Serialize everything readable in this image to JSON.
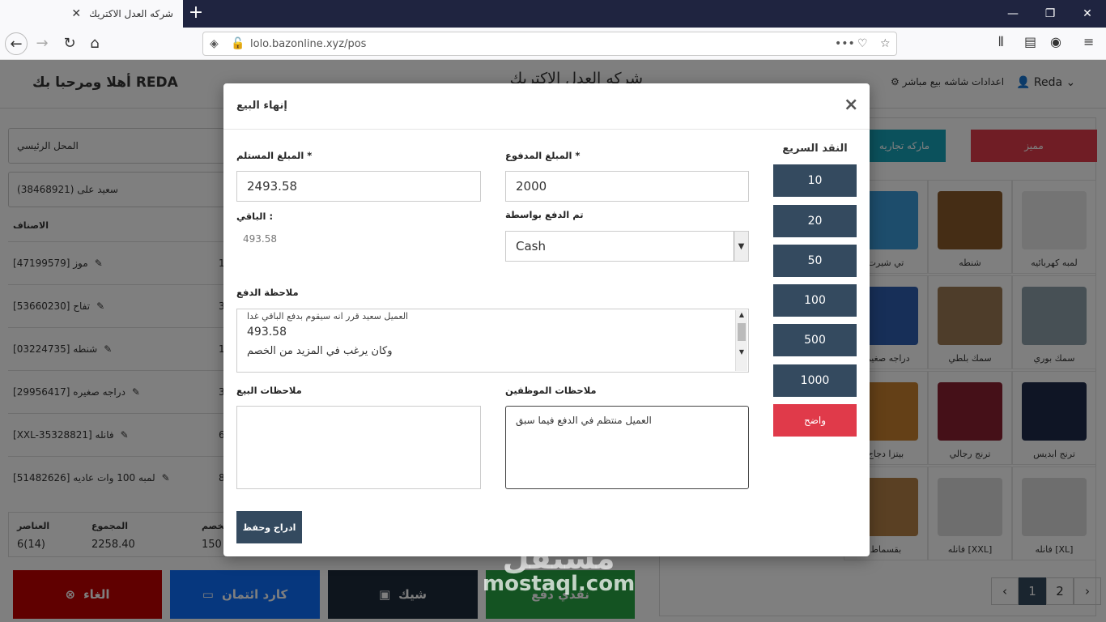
{
  "browser": {
    "tab_title": "شركه العدل الاكتريك",
    "url": "lolo.bazonline.xyz/pos"
  },
  "header": {
    "greeting_name": "REDA",
    "greeting_text": "أهلا ومرحبا بك",
    "company_name": "شركه العدل الاكتريك",
    "settings_label": "اعدادات شاشه بيع مباشر",
    "direct_sale_label": "بيع مباشر",
    "user_name": "Reda"
  },
  "left_panel": {
    "location": "المحل الرئيسي",
    "customer": "سعيد على (38468921)",
    "items_header": "الاصناف",
    "items": [
      {
        "label": "موز [47199579]",
        "qty": "1"
      },
      {
        "label": "تفاح [53660230]",
        "qty": "3"
      },
      {
        "label": "شنطه [03224735]",
        "qty": "1"
      },
      {
        "label": "دراجه صغيره [29956417]",
        "qty": "3"
      },
      {
        "label": "فانله [XXL-35328821]",
        "qty": "6"
      },
      {
        "label": "لمبه 100 وات عاديه [51482626]",
        "qty": "8"
      }
    ],
    "totals": {
      "items_label": "العناصر",
      "items_value": "6(14)",
      "total_label": "المجموع",
      "total_value": "2258.40",
      "discount_label": "الخصم",
      "discount_value": "150"
    }
  },
  "bottom_buttons": {
    "cancel": "الغاء",
    "credit": "كارد ائتمان",
    "cheque": "شيك",
    "cash": "نقدي دفع"
  },
  "right_panel": {
    "category_featured": "مميز",
    "category_brand": "ماركه تجاريه",
    "products": [
      {
        "name": "لمبه كهربائيه",
        "color": "#e8e8e8"
      },
      {
        "name": "شنطه",
        "color": "#8a5a2b"
      },
      {
        "name": "تي شيرت",
        "color": "#3a9ad9"
      },
      {
        "name": "سمك بوري",
        "color": "#8fa0ab"
      },
      {
        "name": "سمك بلطي",
        "color": "#9c7a54"
      },
      {
        "name": "دراجه صغيره",
        "color": "#2f5fb0"
      },
      {
        "name": "ترنج ابديس",
        "color": "#1e2a4a"
      },
      {
        "name": "ترنج رجالي",
        "color": "#8b2030"
      },
      {
        "name": "بيتزا دجاج",
        "color": "#c9812e"
      },
      {
        "name": "فانله [XL]",
        "color": "#dcdcdc"
      },
      {
        "name": "فانله [XXL]",
        "color": "#dcdcdc"
      },
      {
        "name": "بقسماط",
        "color": "#b48046"
      }
    ],
    "pagination": {
      "prev": "‹",
      "page1": "1",
      "page2": "2",
      "next": "›"
    }
  },
  "modal": {
    "title": "إنهاء البيع",
    "close": "×",
    "received_label": "* المبلغ المستلم",
    "received_value": "2493.58",
    "paid_label": "* المبلغ المدفوع",
    "paid_value": "2000",
    "remaining_label": ": الباقي",
    "remaining_value": "493.58",
    "method_label": "تم الدفع بواسطة",
    "method_value": "Cash",
    "payment_note_label": "ملاحظة الدفع",
    "payment_note_lines": [
      "العميل سعيد قرر انه سيقوم بدفع الباقي غدا",
      "493.58",
      "وكان يرغب في المزيد من الخصم"
    ],
    "sale_notes_label": "ملاحظات البيع",
    "staff_notes_label": "ملاحظات الموظفين",
    "staff_notes_value": "العميل منتظم في الدفع فيما سبق",
    "submit_label": "ادراج وحفظ",
    "quick_cash_title": "النقد السريع",
    "quick_cash": [
      "10",
      "20",
      "50",
      "100",
      "500",
      "1000"
    ],
    "clear_label": "واضح"
  },
  "watermark": {
    "brand_ar": "مستقل",
    "brand_en": "mostaql.com"
  },
  "colors": {
    "accent": "#344a5f",
    "danger": "#e03a4a",
    "teal": "#17a2b8"
  }
}
